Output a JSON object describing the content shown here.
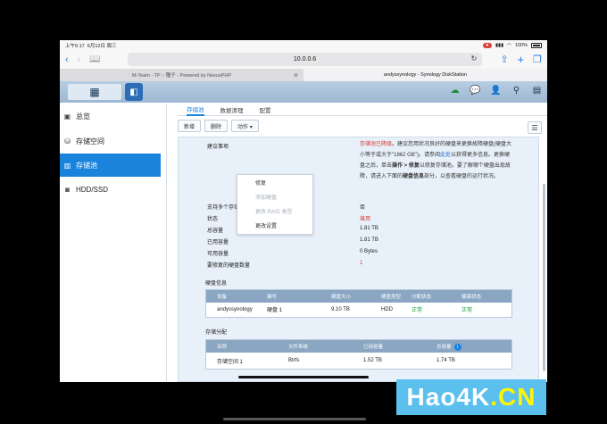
{
  "status": {
    "time": "上午6:17",
    "date": "6月12日 周三",
    "battery": "100%"
  },
  "browser": {
    "address": "10.0.0.6",
    "tabs": [
      {
        "label": "M-Team - TP :: 種子 - Powered by NexusPHP",
        "active": false
      },
      {
        "label": "andyssynology - Synology DiskStation",
        "active": true
      }
    ]
  },
  "sidebar": {
    "items": [
      {
        "label": "总览",
        "icon": "overview-icon"
      },
      {
        "label": "存储空间",
        "icon": "storage-space-icon"
      },
      {
        "label": "存储池",
        "icon": "storage-pool-icon",
        "active": true
      },
      {
        "label": "HDD/SSD",
        "icon": "hdd-icon"
      }
    ]
  },
  "subtabs": [
    "存储池",
    "数据清理",
    "配置"
  ],
  "toolbar": {
    "create": "新增",
    "delete": "删除",
    "action": "动作 ▾"
  },
  "action_menu": [
    "修复",
    "添加硬盘",
    "更改 RAID 类型",
    "更改设置"
  ],
  "details": {
    "suggest_label": "建议事项",
    "suggest_red": "存储池已降级",
    "suggest_text_1": "。建议您用状况良好的硬盘来更换故障硬盘(硬盘大小等于或大于\"1862 GB\")。请参阅",
    "suggest_link": "此处",
    "suggest_text_2": "以获得更多信息。更换硬盘之后，单击",
    "suggest_bold1": "操作 > 修复",
    "suggest_text_3": "以修复存储池。要了解哪个硬盘出现故障，请进入下面的",
    "suggest_bold2": "硬盘信息",
    "suggest_text_4": "部分，以查看硬盘的运行状况。",
    "rows": [
      {
        "label": "支持多个存储空间",
        "value": "否"
      },
      {
        "label": "状态",
        "value": "堪用"
      },
      {
        "label": "总容量",
        "value": "1.81 TB"
      },
      {
        "label": "已用容量",
        "value": "1.81 TB"
      },
      {
        "label": "可用容量",
        "value": "0 Bytes"
      },
      {
        "label": "要修复的硬盘数量",
        "value": "1"
      }
    ]
  },
  "disk_info": {
    "title": "硬盘信息",
    "headers": [
      "设备",
      "编号",
      "硬盘大小",
      "硬盘类型",
      "分配状态",
      "健康状态"
    ],
    "row": [
      "andyssynology",
      "硬盘 1",
      "9.10 TB",
      "HDD",
      "正常",
      "正常"
    ]
  },
  "storage_alloc": {
    "title": "存储分配",
    "headers": [
      "名称",
      "文件系统",
      "已用容量",
      "总容量"
    ],
    "row": [
      "存储空间 1",
      "Btrfs",
      "1.52 TB",
      "1.74 TB"
    ]
  },
  "watermark": {
    "a": "Hao4K",
    "b": ".CN"
  }
}
